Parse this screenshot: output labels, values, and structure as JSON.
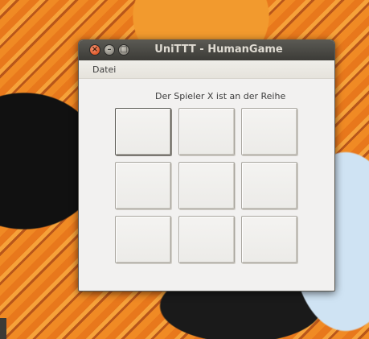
{
  "window": {
    "title": "UniTTT - HumanGame",
    "controls": {
      "close_icon": "×",
      "minimize_icon": "–",
      "maximize_icon": "□"
    }
  },
  "menubar": {
    "items": [
      {
        "label": "Datei"
      }
    ]
  },
  "status": {
    "text": "Der Spieler X ist an der Reihe"
  },
  "board": {
    "cells": [
      "",
      "",
      "",
      "",
      "",
      "",
      "",
      "",
      ""
    ],
    "focused_index": 0
  }
}
